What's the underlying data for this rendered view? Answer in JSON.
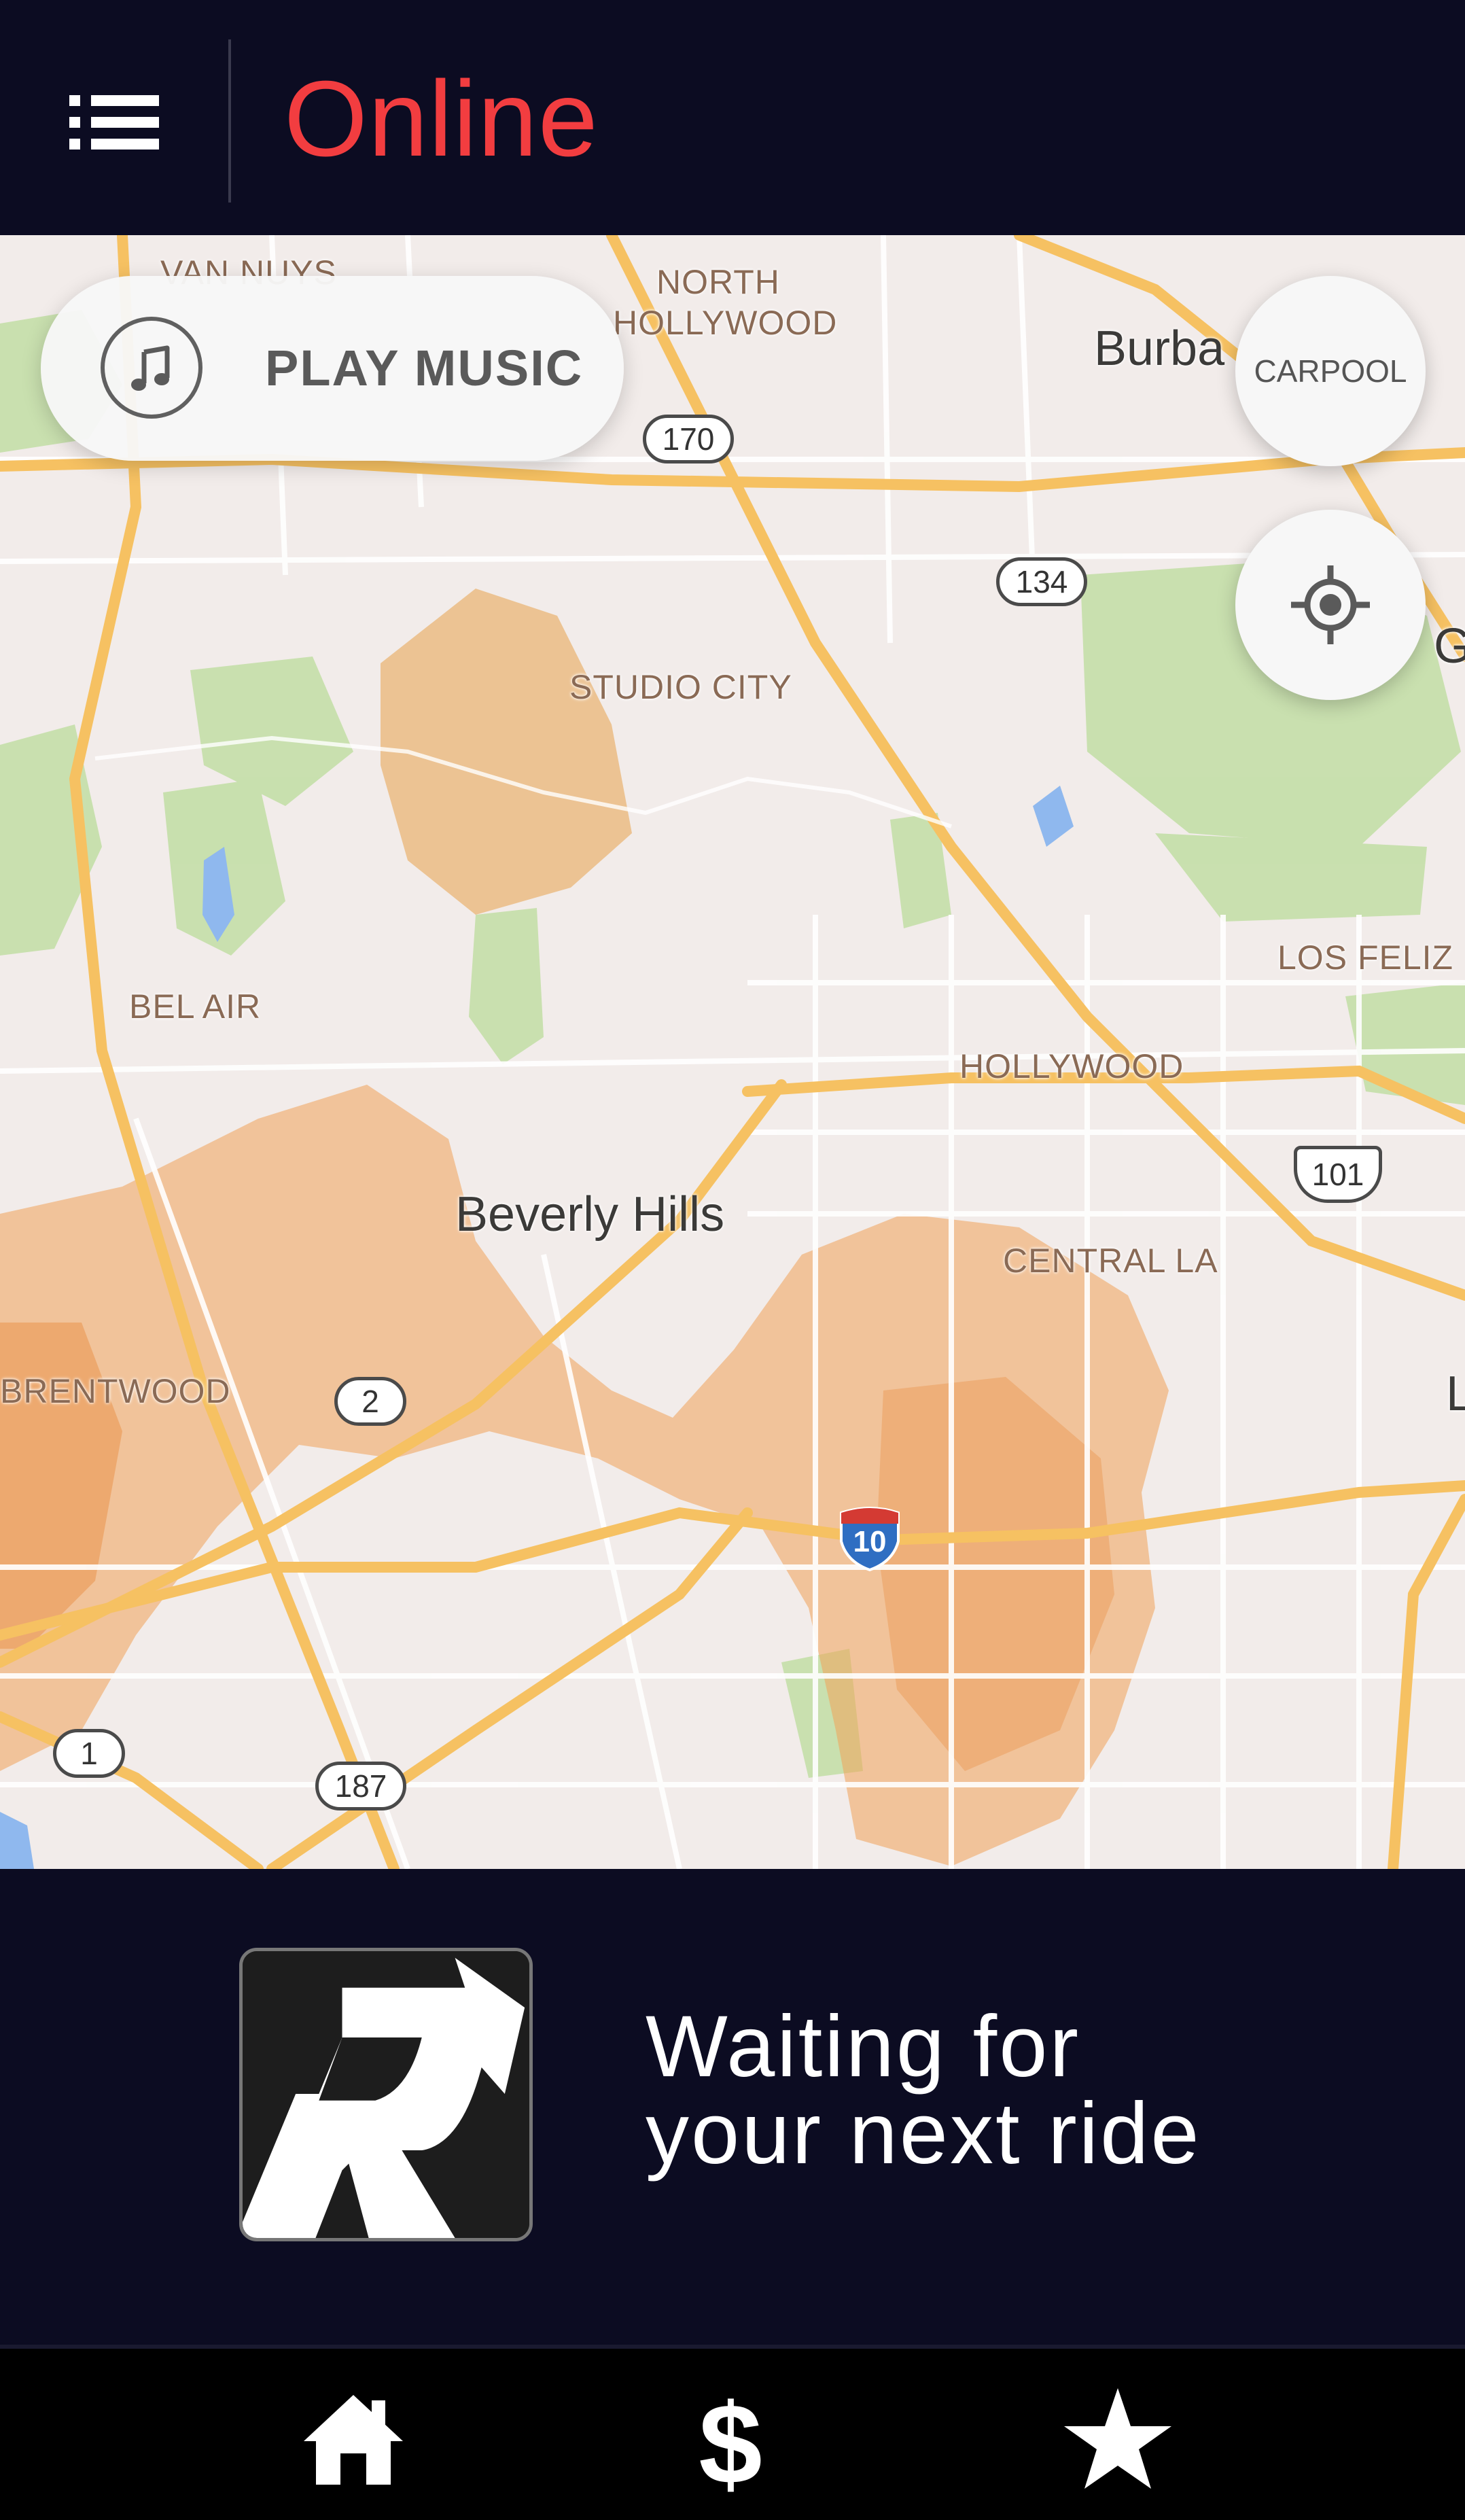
{
  "header": {
    "status": "Online",
    "status_color": "#f23d40",
    "menu_icon": "list-icon"
  },
  "map": {
    "play_music_label": "PLAY MUSIC",
    "music_icon": "music-note-icon",
    "carpool_label": "CARPOOL",
    "locate_icon": "crosshair-icon",
    "places": {
      "van_nuys": "VAN NUYS",
      "north_hollywood_1": "NORTH",
      "north_hollywood_2": "HOLLYWOOD",
      "burbank": "Burba",
      "studio_city": "STUDIO CITY",
      "los_feliz": "LOS FELIZ",
      "bel_air": "BEL AIR",
      "hollywood": "HOLLYWOOD",
      "beverly_hills": "Beverly Hills",
      "central_la": "CENTRAL LA",
      "brentwood": "BRENTWOOD",
      "edge_g": "G",
      "edge_l": "L"
    },
    "route_shields": {
      "r170": "170",
      "r134": "134",
      "r101": "101",
      "r2": "2",
      "r1": "1",
      "r187": "187",
      "i10": "10"
    }
  },
  "waiting": {
    "line1": "Waiting for",
    "line2": "your next ride",
    "logo": "r-logo"
  },
  "nav": {
    "home_icon": "home-icon",
    "earnings_icon": "dollar-icon",
    "ratings_icon": "star-icon"
  }
}
